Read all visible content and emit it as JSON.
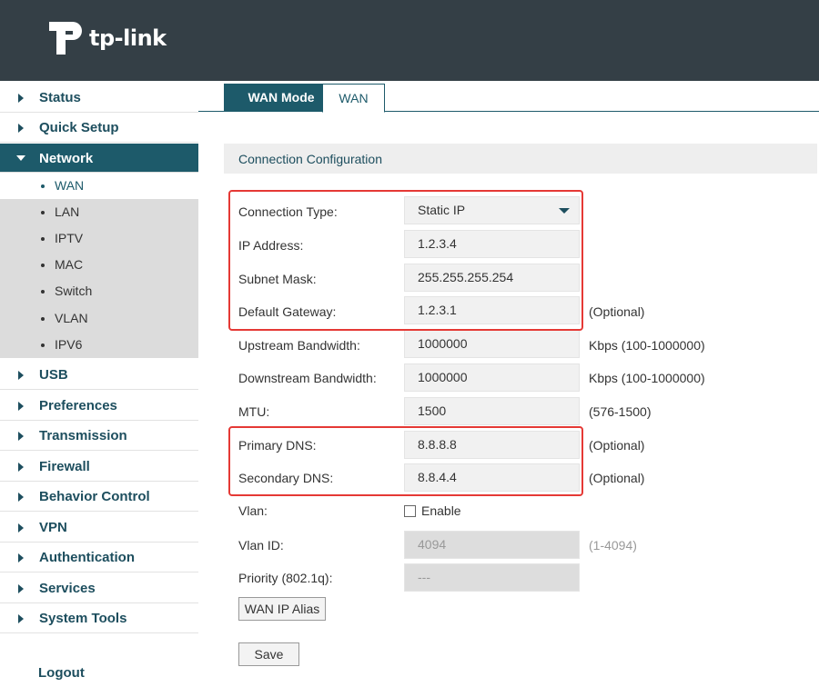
{
  "brand": {
    "logo_text": "tp-link"
  },
  "sidebar": {
    "items": [
      {
        "label": "Status"
      },
      {
        "label": "Quick Setup"
      },
      {
        "label": "Network"
      },
      {
        "label": "USB"
      },
      {
        "label": "Preferences"
      },
      {
        "label": "Transmission"
      },
      {
        "label": "Firewall"
      },
      {
        "label": "Behavior Control"
      },
      {
        "label": "VPN"
      },
      {
        "label": "Authentication"
      },
      {
        "label": "Services"
      },
      {
        "label": "System Tools"
      }
    ],
    "network_sub": [
      {
        "label": "WAN"
      },
      {
        "label": "LAN"
      },
      {
        "label": "IPTV"
      },
      {
        "label": "MAC"
      },
      {
        "label": "Switch"
      },
      {
        "label": "VLAN"
      },
      {
        "label": "IPV6"
      }
    ],
    "logout": "Logout"
  },
  "tabs": [
    {
      "label": "WAN Mode"
    },
    {
      "label": "WAN"
    }
  ],
  "section_title": "Connection Configuration",
  "form": {
    "connection_type": {
      "label": "Connection Type:",
      "value": "Static IP"
    },
    "ip_address": {
      "label": "IP Address:",
      "value": "1.2.3.4"
    },
    "subnet_mask": {
      "label": "Subnet Mask:",
      "value": "255.255.255.254"
    },
    "default_gateway": {
      "label": "Default Gateway:",
      "value": "1.2.3.1",
      "hint": "(Optional)"
    },
    "upstream_bandwidth": {
      "label": "Upstream Bandwidth:",
      "value": "1000000",
      "hint": "Kbps (100-1000000)"
    },
    "downstream_bandwidth": {
      "label": "Downstream Bandwidth:",
      "value": "1000000",
      "hint": "Kbps (100-1000000)"
    },
    "mtu": {
      "label": "MTU:",
      "value": "1500",
      "hint": "(576-1500)"
    },
    "primary_dns": {
      "label": "Primary DNS:",
      "value": "8.8.8.8",
      "hint": "(Optional)"
    },
    "secondary_dns": {
      "label": "Secondary DNS:",
      "value": "8.8.4.4",
      "hint": "(Optional)"
    },
    "vlan": {
      "label": "Vlan:",
      "checkbox_label": "Enable"
    },
    "vlan_id": {
      "label": "Vlan ID:",
      "value": "4094",
      "hint": "(1-4094)"
    },
    "priority": {
      "label": "Priority (802.1q):",
      "value": "---"
    }
  },
  "buttons": {
    "wan_ip_alias": "WAN IP Alias",
    "save": "Save"
  },
  "colors": {
    "header_bg": "#343f46",
    "accent": "#1d5a6a",
    "highlight_box": "#e53935"
  }
}
